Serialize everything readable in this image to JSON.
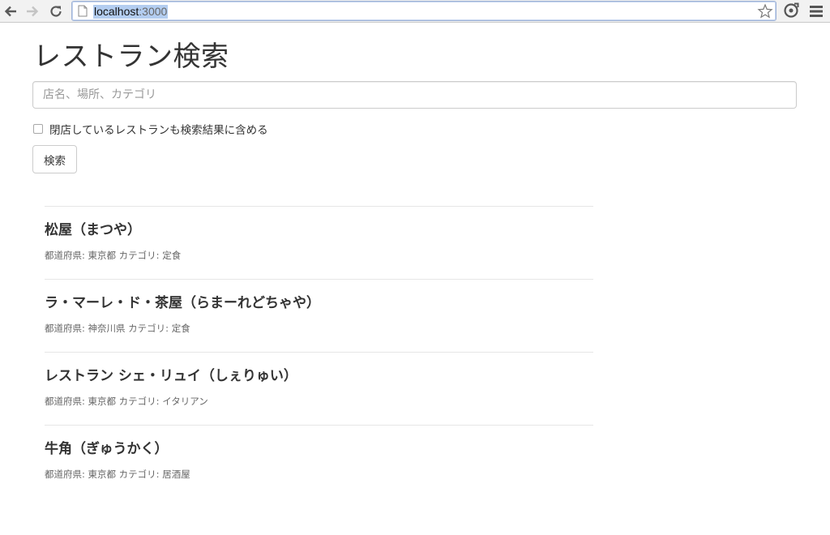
{
  "browser": {
    "url_host": "localhost",
    "url_port": ":3000"
  },
  "page": {
    "title": "レストラン検索",
    "search_placeholder": "店名、場所、カテゴリ",
    "include_closed_label": "閉店しているレストランも検索結果に含める",
    "include_closed_checked": false,
    "search_button_label": "検索"
  },
  "results": [
    {
      "name": "松屋（まつや）",
      "meta": "都道府県: 東京都 カテゴリ: 定食"
    },
    {
      "name": "ラ・マーレ・ド・茶屋（らまーれどちゃや）",
      "meta": "都道府県: 神奈川県 カテゴリ: 定食"
    },
    {
      "name": "レストラン シェ・リュイ（しぇりゅい）",
      "meta": "都道府県: 東京都 カテゴリ: イタリアン"
    },
    {
      "name": "牛角（ぎゅうかく）",
      "meta": "都道府県: 東京都 カテゴリ: 居酒屋"
    }
  ],
  "colors": {
    "text": "#333333",
    "muted": "#666666",
    "border": "#cccccc",
    "url_selection": "#b3cdf0"
  }
}
